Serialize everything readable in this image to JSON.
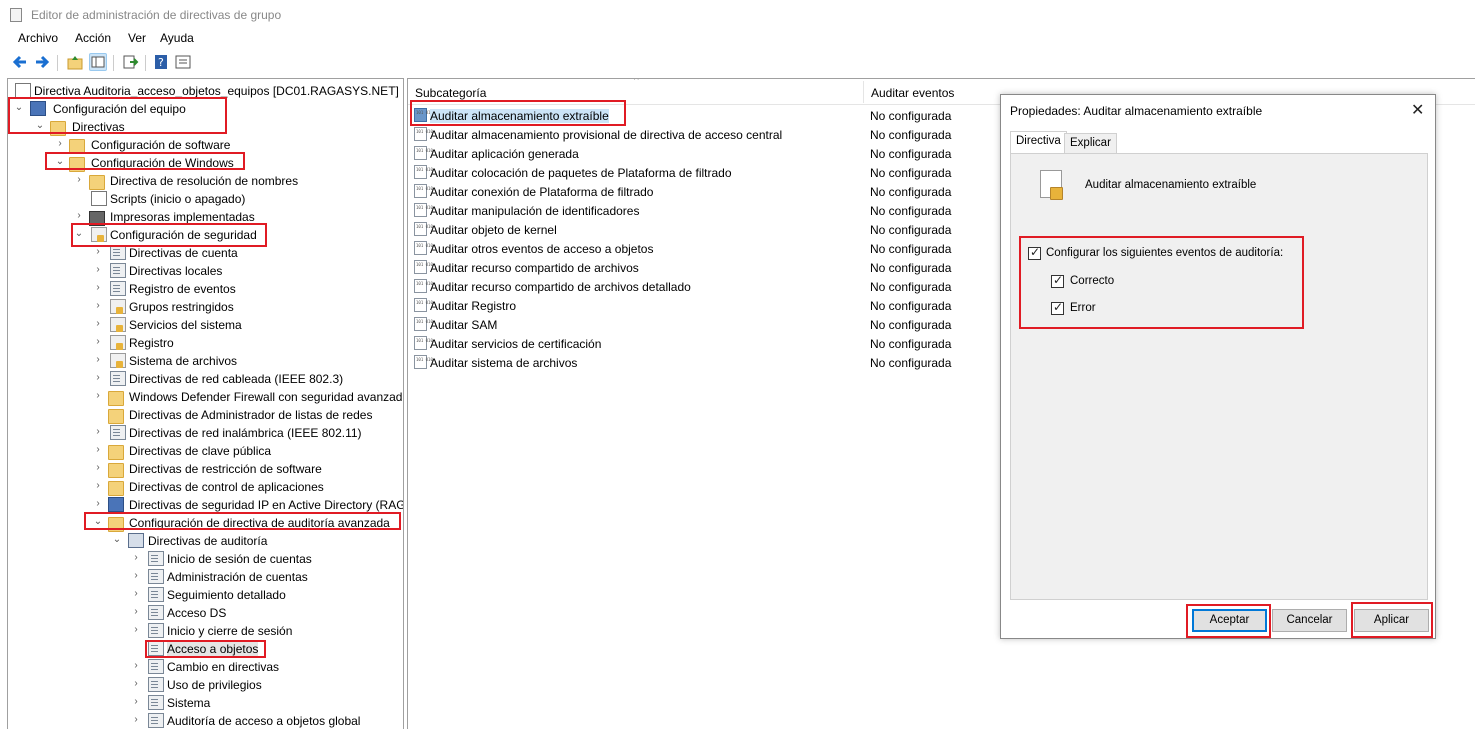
{
  "window": {
    "title": "Editor de administración de directivas de grupo"
  },
  "menu": {
    "items": [
      "Archivo",
      "Acción",
      "Ver",
      "Ayuda"
    ]
  },
  "tree": {
    "root": "Directiva Auditoria_acceso_objetos_equipos [DC01.RAGASYS.NET]",
    "items": [
      "Configuración del equipo",
      "Directivas",
      "Configuración de software",
      "Configuración de Windows",
      "Directiva de resolución de nombres",
      "Scripts (inicio o apagado)",
      "Impresoras implementadas",
      "Configuración de seguridad",
      "Directivas de cuenta",
      "Directivas locales",
      "Registro de eventos",
      "Grupos restringidos",
      "Servicios del sistema",
      "Registro",
      "Sistema de archivos",
      "Directivas de red cableada (IEEE 802.3)",
      "Windows Defender Firewall con seguridad avanzada",
      "Directivas de Administrador de listas de redes",
      "Directivas de red inalámbrica (IEEE 802.11)",
      "Directivas de clave pública",
      "Directivas de restricción de software",
      "Directivas de control de aplicaciones",
      "Directivas de seguridad IP en Active Directory (RAGA",
      "Configuración de directiva de auditoría avanzada",
      "Directivas de auditoría",
      "Inicio de sesión de cuentas",
      "Administración de cuentas",
      "Seguimiento detallado",
      "Acceso DS",
      "Inicio y cierre de sesión",
      "Acceso a objetos",
      "Cambio en directivas",
      "Uso de privilegios",
      "Sistema",
      "Auditoría de acceso a objetos global"
    ]
  },
  "list": {
    "col_subcategory": "Subcategoría",
    "col_audit": "Auditar eventos",
    "rows": [
      {
        "name": "Auditar almacenamiento extraíble",
        "value": "No configurada"
      },
      {
        "name": "Auditar almacenamiento provisional de directiva de acceso central",
        "value": "No configurada"
      },
      {
        "name": "Auditar aplicación generada",
        "value": "No configurada"
      },
      {
        "name": "Auditar colocación de paquetes de Plataforma de filtrado",
        "value": "No configurada"
      },
      {
        "name": "Auditar conexión de Plataforma de filtrado",
        "value": "No configurada"
      },
      {
        "name": "Auditar manipulación de identificadores",
        "value": "No configurada"
      },
      {
        "name": "Auditar objeto de kernel",
        "value": "No configurada"
      },
      {
        "name": "Auditar otros eventos de acceso a objetos",
        "value": "No configurada"
      },
      {
        "name": "Auditar recurso compartido de archivos",
        "value": "No configurada"
      },
      {
        "name": "Auditar recurso compartido de archivos detallado",
        "value": "No configurada"
      },
      {
        "name": "Auditar Registro",
        "value": "No configurada"
      },
      {
        "name": "Auditar SAM",
        "value": "No configurada"
      },
      {
        "name": "Auditar servicios de certificación",
        "value": "No configurada"
      },
      {
        "name": "Auditar sistema de archivos",
        "value": "No configurada"
      }
    ]
  },
  "dialog": {
    "title": "Propiedades: Auditar almacenamiento extraíble",
    "tab_policy": "Directiva",
    "tab_explain": "Explicar",
    "policy_name": "Auditar almacenamiento extraíble",
    "configure_label": "Configurar los siguientes eventos de auditoría:",
    "success_label": "Correcto",
    "failure_label": "Error",
    "ok": "Aceptar",
    "cancel": "Cancelar",
    "apply": "Aplicar"
  },
  "colors": {
    "highlight": "#e01b24",
    "selection": "#cce4f7",
    "accent": "#0078d7"
  }
}
